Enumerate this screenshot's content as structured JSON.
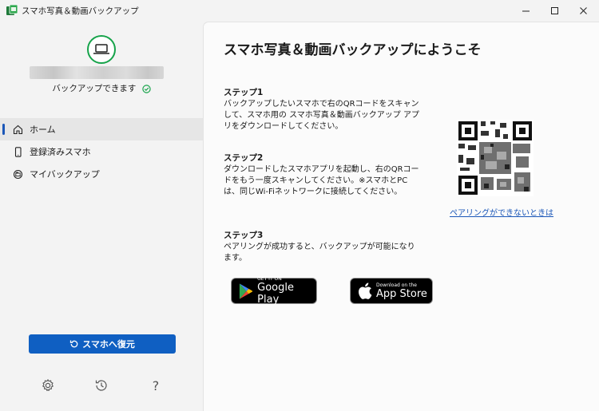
{
  "window": {
    "title": "スマホ写真＆動画バックアップ",
    "minimize_glyph": "—",
    "maximize_glyph": "☐",
    "close_glyph": "✕"
  },
  "sidebar": {
    "device_status": "バックアップできます",
    "nav": [
      {
        "label": "ホーム",
        "icon": "home-icon",
        "active": true
      },
      {
        "label": "登録済みスマホ",
        "icon": "smartphone-icon",
        "active": false
      },
      {
        "label": "マイバックアップ",
        "icon": "backup-folder-icon",
        "active": false
      }
    ],
    "restore_button": "スマホへ復元",
    "bottom_icons": [
      "settings-icon",
      "history-icon",
      "help-icon"
    ],
    "help_glyph": "?"
  },
  "main": {
    "heading": "スマホ写真＆動画バックアップにようこそ",
    "steps": [
      {
        "title": "ステップ1",
        "text": "バックアップしたいスマホで右のQRコードをスキャンして、スマホ用の スマホ写真＆動画バックアップ アプリをダウンロードしてください。"
      },
      {
        "title": "ステップ2",
        "text": "ダウンロードしたスマホアプリを起動し、右のQRコードをもう一度スキャンしてください。※スマホとPCは、同じWi-Fiネットワークに接続してください。"
      },
      {
        "title": "ステップ3",
        "text": "ペアリングが成功すると、バックアップが可能になります。"
      }
    ],
    "pairing_link": "ペアリングができないときは",
    "google_play": {
      "small": "GET IT ON",
      "big": "Google Play"
    },
    "app_store": {
      "small": "Download on the",
      "big": "App Store"
    }
  },
  "colors": {
    "accent": "#0f5fc2",
    "success": "#16a34a",
    "link": "#1b57b8"
  }
}
